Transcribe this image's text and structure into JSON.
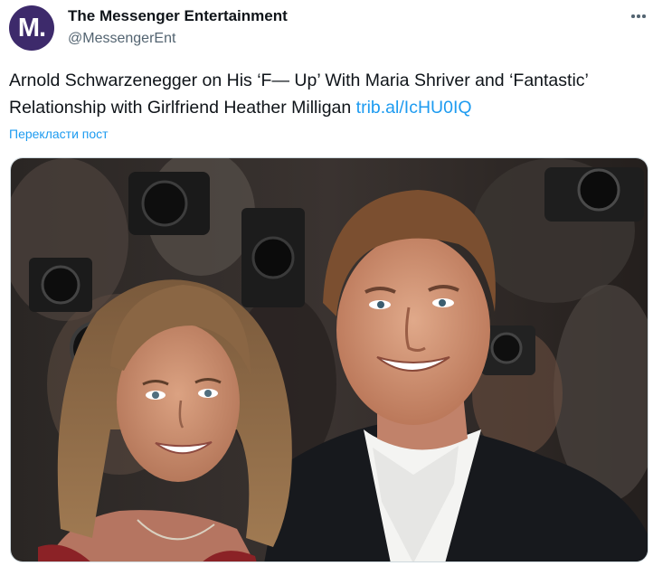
{
  "author": {
    "avatar_text": "M.",
    "display_name": "The Messenger Entertainment",
    "handle": "@MessengerEnt"
  },
  "post": {
    "text": "Arnold Schwarzenegger on His ‘F— Up’ With Maria Shriver and ‘Fantastic’ Relationship with Girlfriend Heather Milligan ",
    "link_text": "trib.al/IcHU0IQ",
    "translate_label": "Перекласти пост"
  },
  "media": {
    "icon": "photo-image"
  },
  "colors": {
    "accent": "#1d9bf0",
    "avatar_bg": "#3d2a6b",
    "secondary_text": "#536471"
  }
}
